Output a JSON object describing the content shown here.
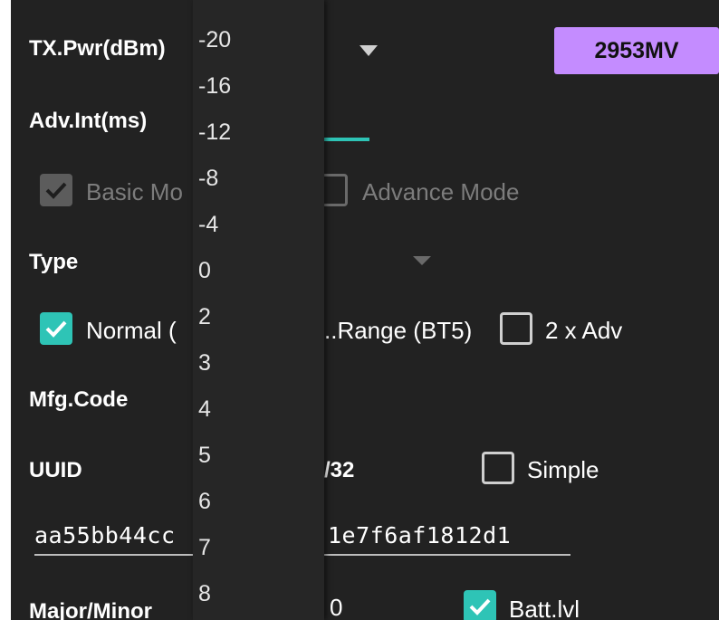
{
  "tx_power": {
    "label": "TX.Pwr(dBm)",
    "options": [
      "-20",
      "-16",
      "-12",
      "-8",
      "-4",
      "0",
      "2",
      "3",
      "4",
      "5",
      "6",
      "7",
      "8"
    ]
  },
  "power_button": {
    "label": "2953MV"
  },
  "adv_interval": {
    "label": "Adv.Int(ms)"
  },
  "mode": {
    "basic_label": "Basic Mo",
    "advance_label": "Advance Mode"
  },
  "type": {
    "label": "Type",
    "normal_label": "Normal (",
    "long_range_label": "..Range (BT5)",
    "double_adv_label": "2 x Adv"
  },
  "mfg_code": {
    "label": "Mfg.Code"
  },
  "uuid": {
    "label": "UUID",
    "format_fragment": "/32",
    "simple_label": "Simple",
    "value_left": "aa55bb44cc",
    "value_right": "1e7f6af1812d1"
  },
  "major_minor": {
    "label": "Major/Minor",
    "value_fragment": "0",
    "batt_label": "Batt.lvl"
  },
  "colors": {
    "background": "#222222",
    "accent": "#2ec4b6",
    "button": "#c48cff"
  }
}
